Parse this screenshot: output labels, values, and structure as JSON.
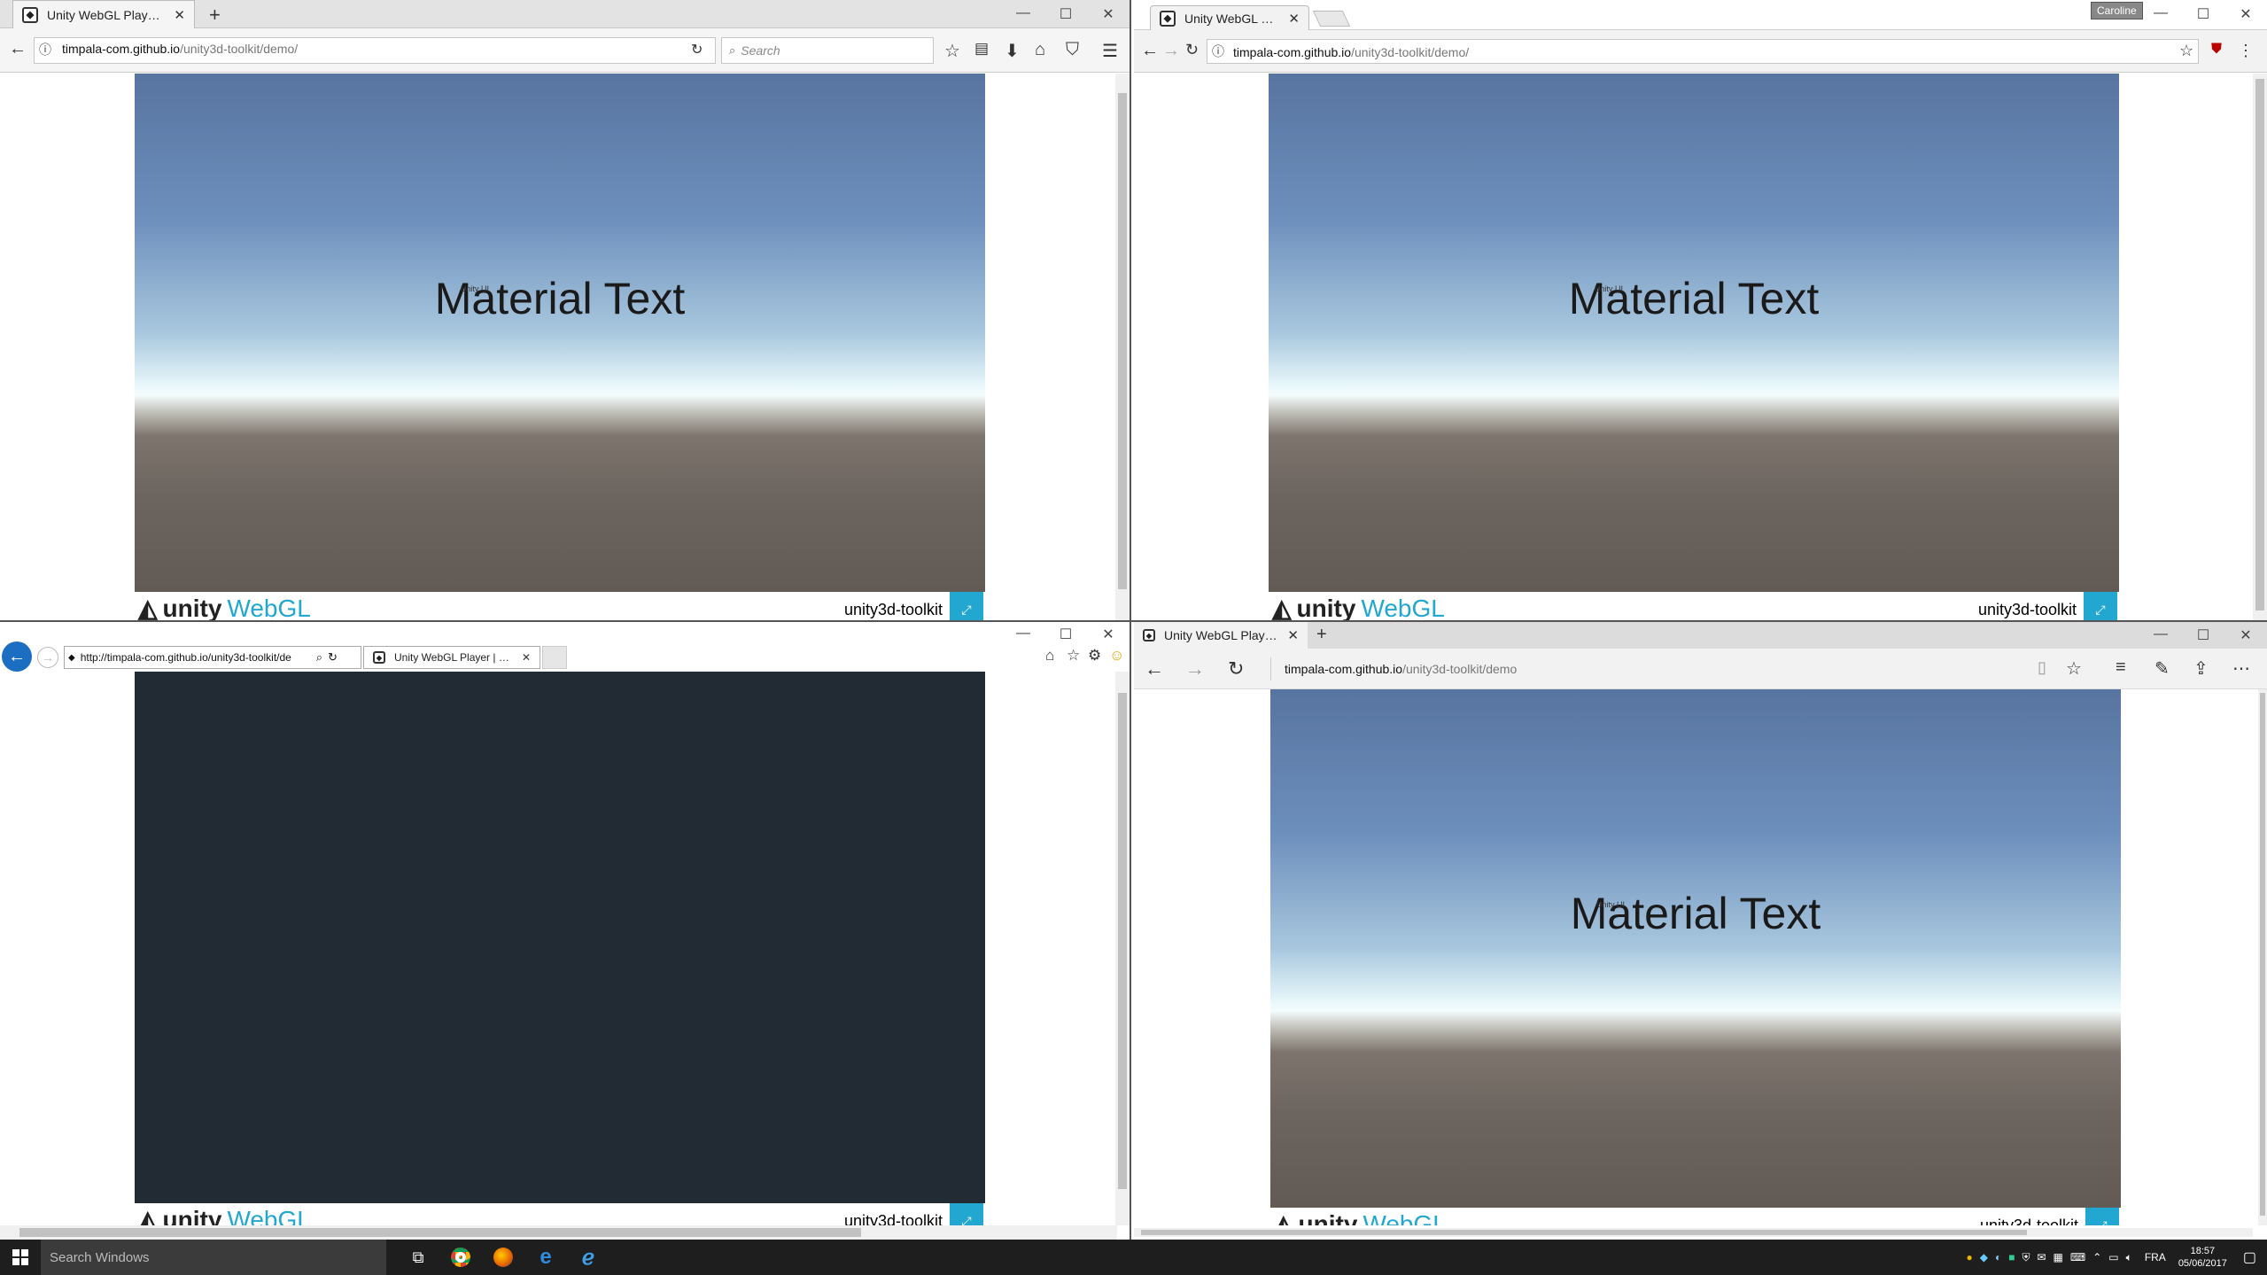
{
  "page_title": "Unity WebGL Player | unity3d-toolkit",
  "windows": [
    {
      "id": "firefox",
      "tab_title": "Unity WebGL Player | unit...",
      "url_host": "timpala-com.github.io",
      "url_path": "/unity3d-toolkit/demo/",
      "search_placeholder": "Search",
      "new_tab": "+",
      "tab_close": "✕",
      "win_min": "—",
      "win_max": "☐",
      "win_close": "✕"
    },
    {
      "id": "chrome",
      "tab_title": "Unity WebGL Player | uni",
      "url_host": "timpala-com.github.io",
      "url_path": "/unity3d-toolkit/demo/",
      "user_badge": "Caroline",
      "tab_close": "✕",
      "win_min": "—",
      "win_max": "☐",
      "win_close": "✕"
    },
    {
      "id": "ie",
      "tab_title": "Unity WebGL Player | unity3...",
      "url_full": "http://timpala-com.github.io/unity3d-toolkit/de",
      "tab_close": "✕",
      "win_min": "—",
      "win_max": "☐",
      "win_close": "✕"
    },
    {
      "id": "edge",
      "tab_title": "Unity WebGL Player | ur",
      "url_host": "timpala-com.github.io",
      "url_path": "/unity3d-toolkit/demo",
      "new_tab": "+",
      "tab_close": "✕",
      "win_min": "—",
      "win_max": "☐",
      "win_close": "✕"
    }
  ],
  "unity": {
    "material_text": "Material Text",
    "tiny_label": "Unity UI",
    "logo_word": "unity",
    "logo_webgl": "WebGL",
    "footer_title": "unity3d-toolkit",
    "fullscreen_glyph": "⤢"
  },
  "taskbar": {
    "search_placeholder": "Search Windows",
    "language": "FRA",
    "time": "18:57",
    "date": "05/06/2017"
  },
  "colors": {
    "accent": "#22a7d1",
    "ie_canvas": "#222a33"
  }
}
